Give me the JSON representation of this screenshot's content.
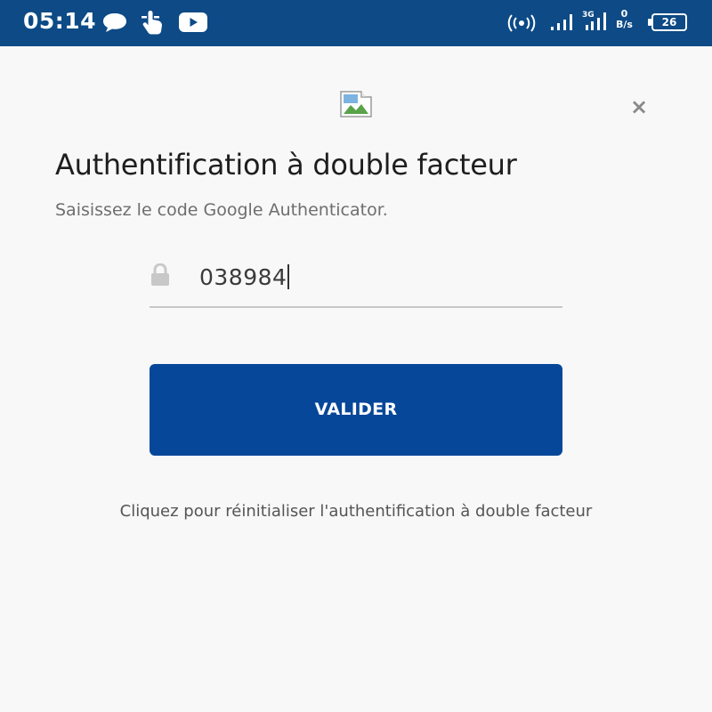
{
  "status_bar": {
    "time": "05:14",
    "net_speed_value": "0",
    "net_speed_unit": "B/s",
    "battery": "26",
    "signal_label": "3G"
  },
  "dialog": {
    "title": "Authentification à double facteur",
    "subtitle": "Saisissez le code Google Authenticator.",
    "code_value": "038984",
    "submit_label": "VALIDER",
    "reset_link": "Cliquez pour réinitialiser l'authentification à double facteur",
    "close_label": "×"
  },
  "colors": {
    "status_bar": "#0d4a86",
    "button": "#07479a",
    "background": "#f8f8f8"
  }
}
